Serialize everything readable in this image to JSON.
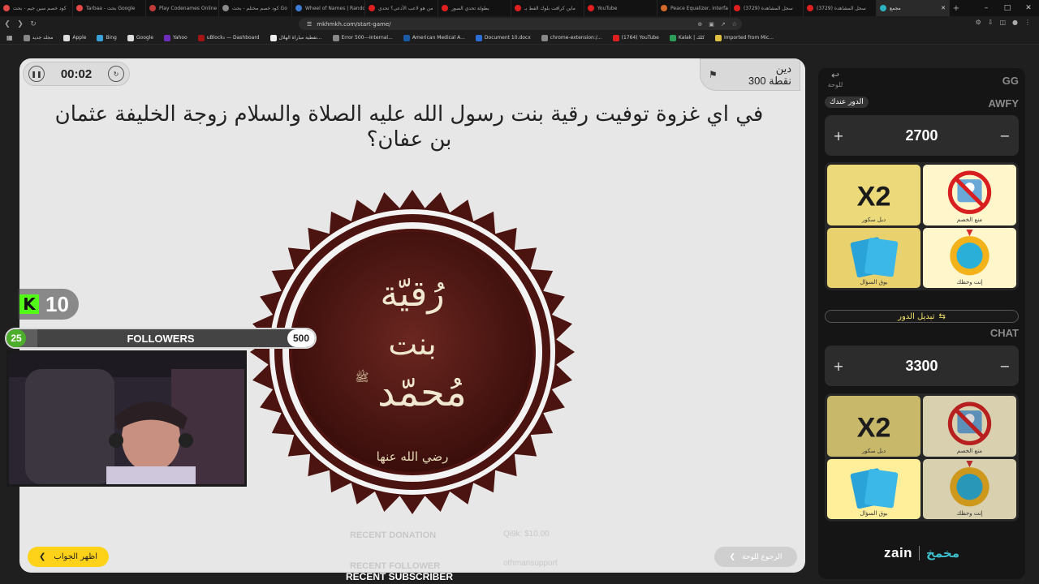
{
  "browser": {
    "tabs": [
      {
        "label": "كود خصم سين جيم - بحث",
        "color": "#e54848"
      },
      {
        "label": "Tarbaa - بحث Google",
        "color": "#e54848"
      },
      {
        "label": "Play Codenames Online",
        "color": "#c23b3b"
      },
      {
        "label": "كود خصم مختلم - بحث Go",
        "color": "#8a8a8a"
      },
      {
        "label": "Wheel of Names | Random",
        "color": "#3b7bd4"
      },
      {
        "label": "من هو لاعب الأدعى؟ تحدي",
        "color": "#e02020"
      },
      {
        "label": "بطولة تحدي الصور",
        "color": "#e02020"
      },
      {
        "label": "ماين كرافت بلوك الفط بـ",
        "color": "#e02020"
      },
      {
        "label": "YouTube",
        "color": "#e02020"
      },
      {
        "label": "Peace Equalizer, interfa",
        "color": "#d46a2a"
      },
      {
        "label": "(3729) سجل المشاهدة",
        "color": "#e02020"
      },
      {
        "label": "(3729) سجل المشاهدة",
        "color": "#e02020"
      },
      {
        "label": "مجمع",
        "color": "#2bb3c0",
        "active": true
      }
    ],
    "url": "mkhmkh.com/start-game/",
    "bookmarks": [
      {
        "label": "مجلد جديد",
        "color": "#888"
      },
      {
        "label": "Apple",
        "color": "#ddd"
      },
      {
        "label": "Bing",
        "color": "#3aa0d8"
      },
      {
        "label": "Google",
        "color": "#ddd"
      },
      {
        "label": "Yahoo",
        "color": "#6f2dbd"
      },
      {
        "label": "uBlock₀ — Dashboard",
        "color": "#a31515"
      },
      {
        "label": "تفطية مباراة الهلال...",
        "color": "#eee"
      },
      {
        "label": "Error 500---Internal...",
        "color": "#888"
      },
      {
        "label": "American Medical A...",
        "color": "#1b5aa6"
      },
      {
        "label": "Document 10.docx",
        "color": "#2b6fd6"
      },
      {
        "label": "chrome-extension:/...",
        "color": "#888"
      },
      {
        "label": "(1764) YouTube",
        "color": "#e02020"
      },
      {
        "label": "Kalak | كلك",
        "color": "#2b9f5a"
      },
      {
        "label": "Imported from Mic...",
        "color": "#e0c040"
      }
    ]
  },
  "game": {
    "timer": "00:02",
    "category": "دين",
    "points": "300 نقطة",
    "question": "في اي غزوة توفيت رقية بنت رسول الله عليه الصلاة والسلام زوجة الخليفة عثمان بن عفان؟",
    "medallion": {
      "line1": "رُقيّة",
      "line2": "بنت",
      "line3": "مُحمّد",
      "honorific": "ﷺ",
      "footer": "رضي الله عنها"
    },
    "show_answer_label": "اظهر الجواب",
    "back_label": "الرجوع للوحة"
  },
  "overlay": {
    "kick_count": "10",
    "followers_label": "FOLLOWERS",
    "followers_current": "25",
    "followers_goal": "500",
    "followers_progress": 0.05,
    "recent_donation_label": "RECENT DONATION",
    "recent_donation_value": "Qi9k: $10.00",
    "recent_follower_label": "RECENT FOLLOWER",
    "recent_follower_value": "othmansupport",
    "recent_subscriber_label": "RECENT SUBSCRIBER"
  },
  "panel": {
    "board_label": "للوحة",
    "game_title": "GG",
    "your_turn_label": "الدور عندك",
    "teams": [
      {
        "name": "AWFY",
        "score": "2700"
      },
      {
        "name": "CHAT",
        "score": "3300"
      }
    ],
    "tools": {
      "double_score": "دبل سكور",
      "block_opponent": "منع الخصم",
      "call_question": "بوق السؤال",
      "your_luck": "إنت وحظك"
    },
    "switch_turn_label": "تبديل الدور",
    "zain_logo": "zain",
    "game_logo": "مخمخ",
    "colors": {
      "accent": "#ffd21a",
      "kick": "#53fc18",
      "brand": "#3ec0cf"
    }
  }
}
